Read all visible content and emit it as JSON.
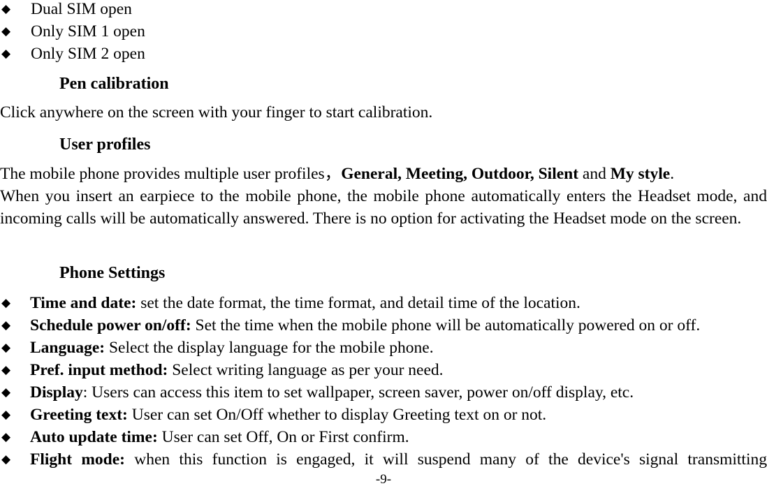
{
  "document": {
    "page_number_label": "-9-",
    "bullet_glyph": "◆"
  },
  "sim_options": [
    {
      "label": "Dual SIM open"
    },
    {
      "label": "Only SIM 1 open"
    },
    {
      "label": "Only SIM 2 open"
    }
  ],
  "sections": {
    "pen_calibration": {
      "heading": "Pen calibration",
      "body": "Click anywhere on the screen with your finger to start calibration."
    },
    "user_profiles": {
      "heading": "User profiles",
      "line1_part1": "The mobile phone provides multiple user profiles，",
      "line1_bold1": "General, Meeting, Outdoor, Silent",
      "line1_mid": " and ",
      "line1_bold2": "My style",
      "line1_end": ".",
      "paragraph": "When you insert an earpiece to the mobile phone, the mobile phone automatically enters the Headset mode, and incoming calls will be automatically answered. There is no option for activating the Headset mode on the screen."
    },
    "phone_settings": {
      "heading": "Phone Settings",
      "items": [
        {
          "term": "Time and date:",
          "description": " set the date format, the time format, and detail time of the location."
        },
        {
          "term": "Schedule power on/off:",
          "description": " Set the time when the mobile phone will be automatically powered on or off."
        },
        {
          "term": "Language:",
          "description": " Select the display language for the mobile phone."
        },
        {
          "term": "Pref. input method:",
          "description": " Select writing language as per your need."
        },
        {
          "term": "Display",
          "description": ": Users can access this item to set wallpaper, screen saver, power on/off display, etc."
        },
        {
          "term": "Greeting text:",
          "description": " User can set On/Off whether to display Greeting text on or not."
        },
        {
          "term": "Auto update time:",
          "description": " User can set Off, On or First confirm."
        },
        {
          "term": "Flight mode:",
          "description": " when this function is engaged, it will suspend many of the device's signal transmitting"
        }
      ]
    }
  }
}
